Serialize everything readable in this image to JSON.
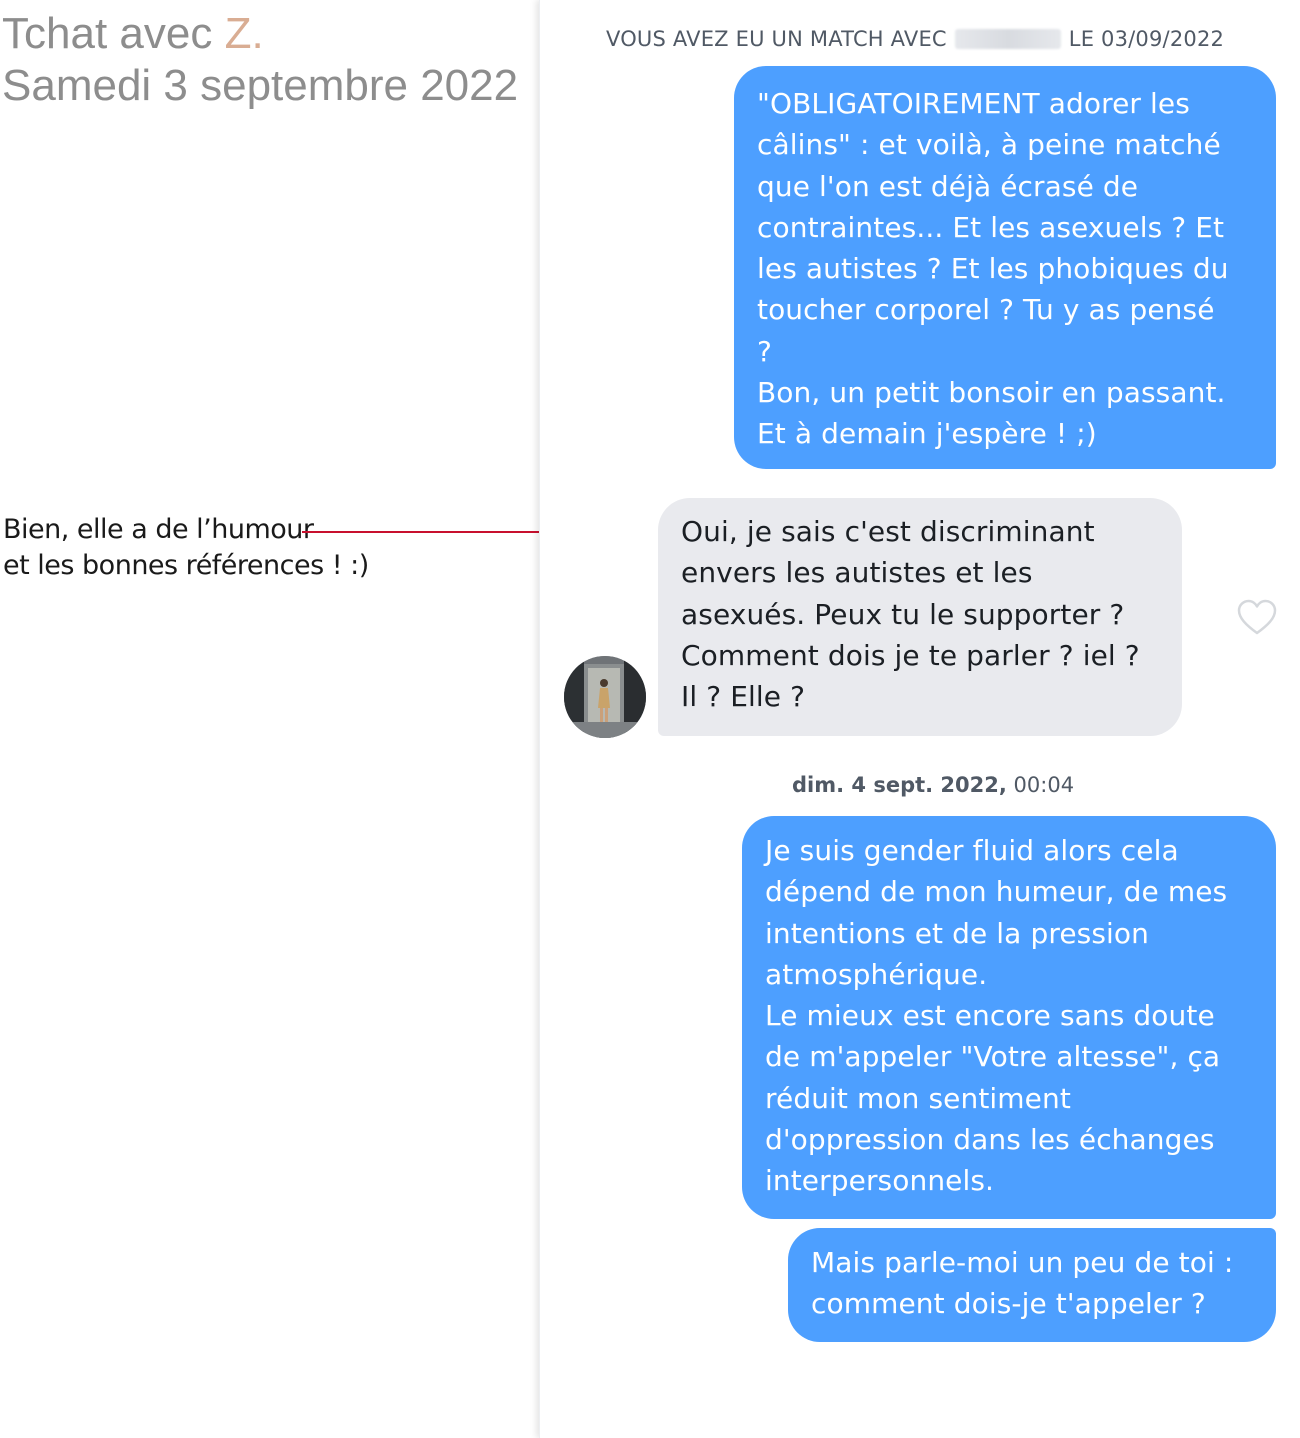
{
  "header": {
    "title_prefix": "Tchat avec ",
    "title_initial": "Z.",
    "date": "Samedi 3 septembre 2022"
  },
  "annotation": {
    "line1": "Bien, elle a de l’humour",
    "line2": "et les bonnes références ! :)"
  },
  "chat": {
    "match_prefix": "VOUS AVEZ EU UN MATCH AVEC",
    "match_suffix": "LE 03/09/2022",
    "messages": [
      {
        "direction": "sent",
        "text": "\"OBLIGATOIREMENT adorer les\ncâlins\" : et voilà, à peine matché\nque l'on est déjà écrasé de\ncontraintes... Et les asexuels ? Et\nles autistes ? Et les phobiques du\ntoucher corporel ? Tu y as pensé\n?\nBon, un petit bonsoir en passant.\nEt à demain j'espère ! ;)"
      },
      {
        "direction": "received",
        "text": "Oui, je sais c'est discriminant\nenvers les autistes et les\nasexués. Peux tu le supporter ?\nComment dois je te parler ? iel ?\nIl ? Elle ?"
      },
      {
        "direction": "sent",
        "text": "Je suis gender fluid alors cela\ndépend de mon humeur, de mes\nintentions et de la pression\natmosphérique.\nLe mieux est encore sans doute\nde m'appeler \"Votre altesse\", ça\nréduit mon sentiment\nd'oppression dans les échanges\ninterpersonnels."
      },
      {
        "direction": "sent",
        "text": "Mais parle-moi un peu de toi :\ncomment dois-je t'appeler ?"
      }
    ],
    "date_separator_bold": "dim. 4 sept. 2022,",
    "date_separator_time": " 00:04"
  },
  "icons": {
    "heart": "heart-outline-icon",
    "avatar": "profile-photo"
  },
  "colors": {
    "sent_bubble": "#4d9fff",
    "received_bubble": "#e9eaee",
    "annotation_line": "#c8102e",
    "title_gray": "#8d8d8d",
    "initial_accent": "#d9ad93"
  }
}
